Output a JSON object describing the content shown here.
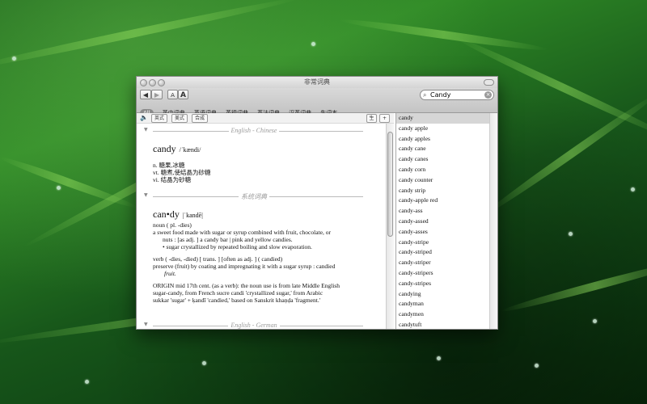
{
  "window": {
    "title": "非常词典"
  },
  "toolbar": {
    "back_label": "◀",
    "forward_label": "▶",
    "font_small_label": "A",
    "font_large_label": "A",
    "search_value": "Candy"
  },
  "tabs": [
    "All",
    "英中词典",
    "英语词典",
    "英德词典",
    "英法词典",
    "汉英词典",
    "生词本"
  ],
  "subtoolbar": {
    "btn1": "英式",
    "btn2": "美式",
    "btn3": "合成"
  },
  "side_buttons": {
    "b1": "生",
    "b2": "+"
  },
  "sections": {
    "english_chinese": "English - Chinese",
    "system": "系统词典",
    "english_german": "English - German"
  },
  "ec_entry": {
    "headword": "candy",
    "pron": "/ˈkændi/",
    "senses": [
      "n. 糖果,冰糖",
      "vt. 糖煮,使结晶为砂糖",
      "vi. 结晶为砂糖"
    ]
  },
  "sys_entry": {
    "headword": "can•dy",
    "pron": "|ˈkandē|",
    "line1": "noun ( pl. -dies)",
    "line2": "a sweet food made with sugar or syrup combined with fruit, chocolate, or",
    "line3": "nuts : [as adj. ] a candy bar | pink and yellow candies.",
    "line4": "• sugar crystallized by repeated boiling and slow evaporation.",
    "line5": "verb ( -dies, -died) [ trans. ] [often as adj. ] ( candied)",
    "line6": "preserve (fruit) by coating and impregnating it with a sugar syrup : candied",
    "line7": "fruit.",
    "line8": "ORIGIN mid 17th cent. (as a verb): the noun use is from late Middle English",
    "line9": "sugar-candy, from French sucre candi 'crystallized sugar,' from Arabic",
    "line10": "sukkar 'sugar' + ḳandī 'candied,' based on Sanskrit khaṇḍa 'fragment.'"
  },
  "word_list": [
    "candy",
    "candy apple",
    "candy apples",
    "candy cane",
    "candy canes",
    "candy corn",
    "candy counter",
    "candy strip",
    "candy-apple red",
    "candy-ass",
    "candy-assed",
    "candy-asses",
    "candy-stripe",
    "candy-striped",
    "candy-striper",
    "candy-stripers",
    "candy-stripes",
    "candying",
    "candyman",
    "candymen",
    "candytuft"
  ]
}
